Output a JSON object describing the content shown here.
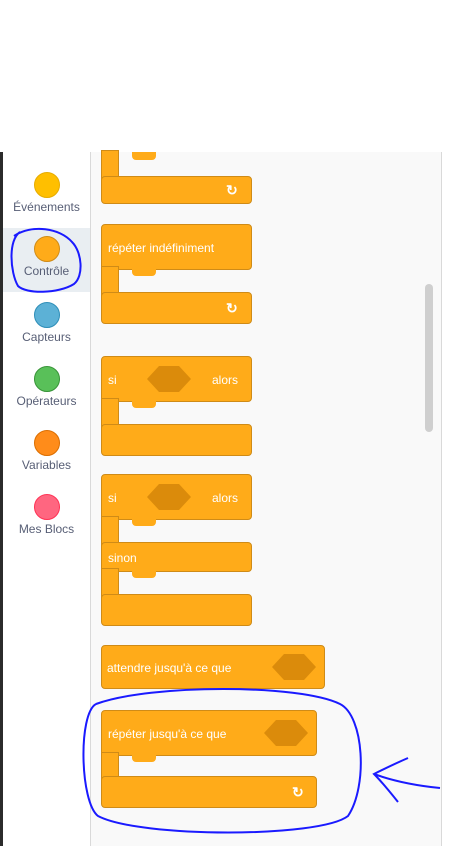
{
  "categories": [
    {
      "label": "Événements",
      "color": "#ffbf00"
    },
    {
      "label": "Contrôle",
      "color": "#ffab19",
      "selected": true
    },
    {
      "label": "Capteurs",
      "color": "#5cb1d6"
    },
    {
      "label": "Opérateurs",
      "color": "#59c059"
    },
    {
      "label": "Variables",
      "color": "#ff8c1a"
    },
    {
      "label": "Mes Blocs",
      "color": "#ff6680"
    }
  ],
  "blocks": {
    "repeat_forever": {
      "label": "répéter indéfiniment"
    },
    "if_then": {
      "if_label": "si",
      "then_label": "alors"
    },
    "if_else": {
      "if_label": "si",
      "then_label": "alors",
      "else_label": "sinon"
    },
    "wait_until": {
      "label": "attendre jusqu'à ce que"
    },
    "repeat_until": {
      "label": "répéter jusqu'à ce que"
    }
  },
  "icons": {
    "loop_arrow": "↻"
  }
}
